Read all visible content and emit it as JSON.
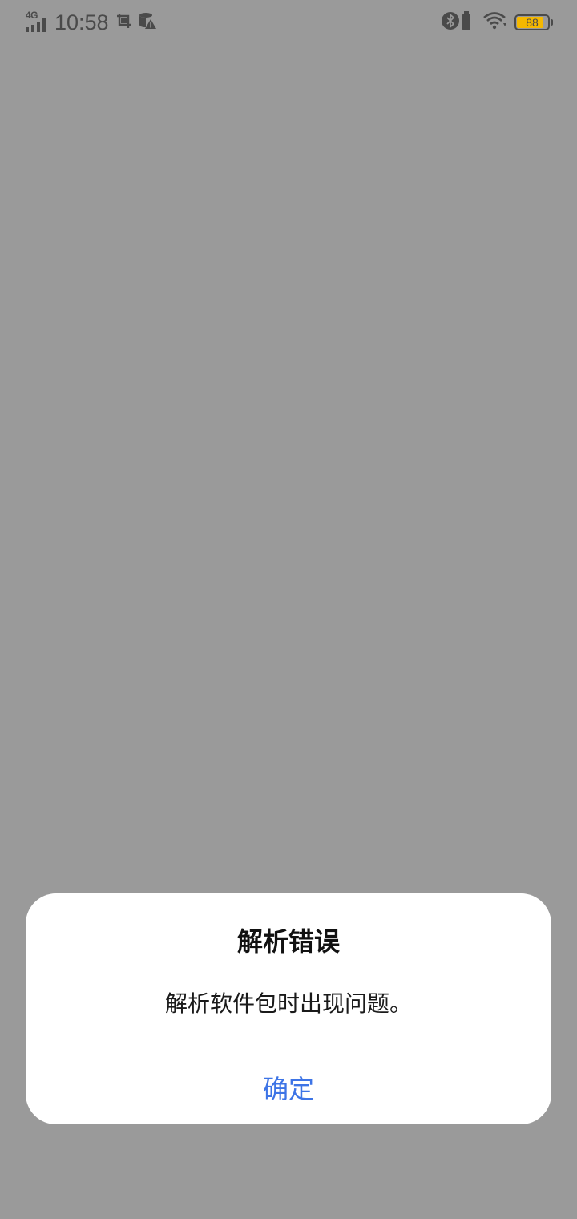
{
  "status_bar": {
    "network_type": "4G",
    "time": "10:58",
    "battery_level": "88",
    "battery_color": "#f5b800",
    "icons": [
      "signal-icon",
      "screenshot-icon",
      "data-warning-icon",
      "bluetooth-icon",
      "battery-saver-icon",
      "wifi-icon",
      "battery-icon"
    ]
  },
  "dialog": {
    "title": "解析错误",
    "message": "解析软件包时出现问题。",
    "confirm_label": "确定",
    "accent_color": "#3d74e6"
  }
}
